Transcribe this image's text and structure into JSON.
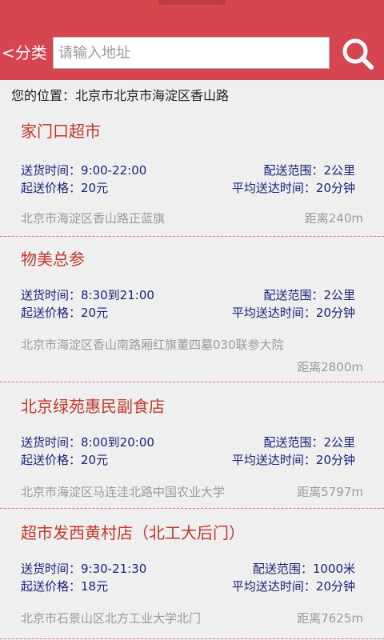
{
  "header": {
    "back_label": "<分类",
    "search_placeholder": "请输入地址",
    "search_icon": "search-icon",
    "accent_color": "#d64651"
  },
  "location": {
    "label": "您的位置：北京市北京市海淀区香山路"
  },
  "stores": [
    {
      "name": "家门口超市",
      "delivery_time": "送货时间：9:00-22:00",
      "min_price": "起送价格：20元",
      "range": "配送范围：2公里",
      "avg_time": "平均送达时间：20分钟",
      "address": "北京市海淀区香山路正蓝旗",
      "distance": "距离240m"
    },
    {
      "name": "物美总参",
      "delivery_time": "送货时间：8:30到21:00",
      "min_price": "起送价格：20元",
      "range": "配送范围：2公里",
      "avg_time": "平均送达时间：20分钟",
      "address": "北京市海淀区香山南路厢红旗董四墓030联参大院",
      "distance": "距离2800m"
    },
    {
      "name": "北京绿苑惠民副食店",
      "delivery_time": "送货时间：8:00到20:00",
      "min_price": "起送价格：20元",
      "range": "配送范围：2公里",
      "avg_time": "平均送达时间：20分钟",
      "address": "北京市海淀区马连洼北路中国农业大学",
      "distance": "距离5797m"
    },
    {
      "name": "超市发西黄村店（北工大后门）",
      "delivery_time": "送货时间：9:30-21:30",
      "min_price": "起送价格：18元",
      "range": "配送范围：1000米",
      "avg_time": "平均送达时间：20分钟",
      "address": "北京市石景山区北方工业大学北门",
      "distance": "距离7625m"
    }
  ]
}
